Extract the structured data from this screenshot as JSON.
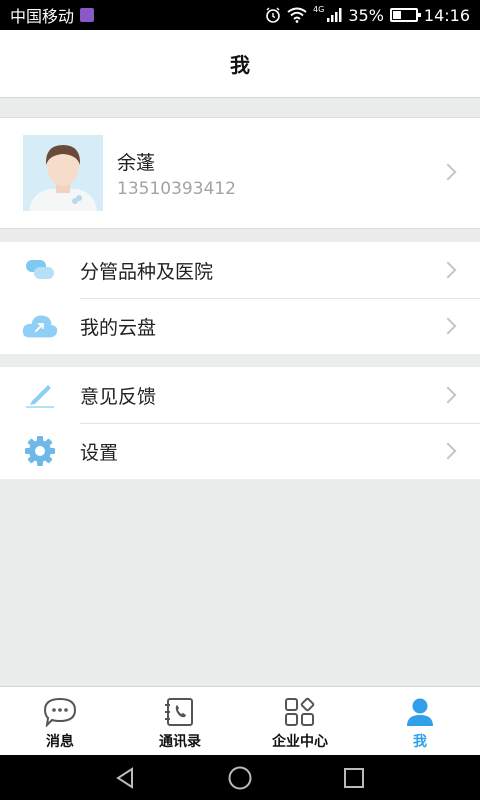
{
  "status_bar": {
    "carrier": "中国移动",
    "network": "4G",
    "battery": "35%",
    "battery_level": 0.35,
    "time": "14:16"
  },
  "header": {
    "title": "我"
  },
  "profile": {
    "name": "余蓬",
    "phone": "13510393412"
  },
  "menu_groups": [
    {
      "items": [
        {
          "label": "分管品种及医院",
          "icon": "capsule-icon"
        },
        {
          "label": "我的云盘",
          "icon": "cloud-icon"
        }
      ]
    },
    {
      "items": [
        {
          "label": "意见反馈",
          "icon": "pen-icon"
        },
        {
          "label": "设置",
          "icon": "gear-icon"
        }
      ]
    }
  ],
  "tabs": [
    {
      "label": "消息",
      "icon": "chat-icon",
      "active": false
    },
    {
      "label": "通讯录",
      "icon": "contacts-icon",
      "active": false
    },
    {
      "label": "企业中心",
      "icon": "grid-icon",
      "active": false
    },
    {
      "label": "我",
      "icon": "person-icon",
      "active": true
    }
  ],
  "colors": {
    "accent": "#32a0e8",
    "icon_light_blue": "#8fcff5",
    "background": "#ebeded"
  }
}
